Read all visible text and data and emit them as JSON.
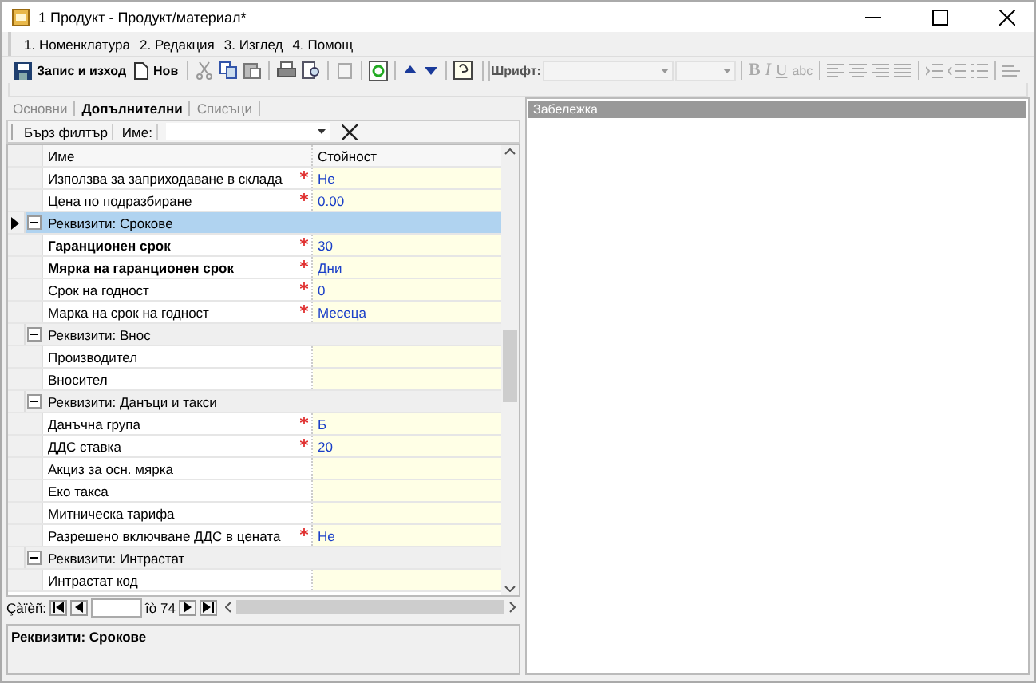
{
  "window": {
    "title": "1 Продукт - Продукт/материал*"
  },
  "menu": [
    "1. Номенклатура",
    "2. Редакция",
    "3. Изглед",
    "4. Помощ"
  ],
  "toolbar": {
    "save_label": "Запис и изход",
    "new_label": "Нов",
    "font_label": "Шрифт:",
    "format_buttons": [
      "B",
      "I",
      "U",
      "abc"
    ]
  },
  "tabs": [
    {
      "label": "Основни",
      "selected": false
    },
    {
      "label": "Допълнителни",
      "selected": true
    },
    {
      "label": "Списъци",
      "selected": false
    }
  ],
  "filter": {
    "label": "Бърз филтър",
    "field_label": "Име:"
  },
  "grid": {
    "columns": [
      "Име",
      "Стойност"
    ],
    "rows": [
      {
        "kind": "field",
        "name": "Използва за заприходаване в склада",
        "bold": false,
        "required": true,
        "value": "Не"
      },
      {
        "kind": "field",
        "name": "Цена по подразбиране",
        "bold": false,
        "required": true,
        "value": "0.00"
      },
      {
        "kind": "group",
        "name": "Реквизити: Срокове",
        "expanded": true,
        "selected": true
      },
      {
        "kind": "field",
        "name": "Гаранционен срок",
        "bold": true,
        "required": true,
        "value": "30"
      },
      {
        "kind": "field",
        "name": "Мярка на гаранционен срок",
        "bold": true,
        "required": true,
        "value": "Дни"
      },
      {
        "kind": "field",
        "name": "Срок на годност",
        "bold": false,
        "required": true,
        "value": "0"
      },
      {
        "kind": "field",
        "name": "Марка на срок на годност",
        "bold": false,
        "required": true,
        "value": "Месеца"
      },
      {
        "kind": "group",
        "name": "Реквизити: Внос",
        "expanded": true,
        "selected": false
      },
      {
        "kind": "field",
        "name": "Производител",
        "bold": false,
        "required": false
      },
      {
        "kind": "field",
        "name": "Вносител",
        "bold": false,
        "required": false
      },
      {
        "kind": "group",
        "name": "Реквизити: Данъци и такси",
        "expanded": true,
        "selected": false
      },
      {
        "kind": "field",
        "name": "Данъчна група",
        "bold": false,
        "required": true,
        "value": "Б"
      },
      {
        "kind": "field",
        "name": "ДДС ставка",
        "bold": false,
        "required": true,
        "value": "20"
      },
      {
        "kind": "field",
        "name": "Акциз за осн. мярка",
        "bold": false,
        "required": false
      },
      {
        "kind": "field",
        "name": "Еко такса",
        "bold": false,
        "required": false
      },
      {
        "kind": "field",
        "name": "Митническа тарифа",
        "bold": false,
        "required": false
      },
      {
        "kind": "field",
        "name": "Разрешено включване ДДС в цената",
        "bold": false,
        "required": true,
        "value": "Не"
      },
      {
        "kind": "group",
        "name": "Реквизити: Интрастат",
        "expanded": true,
        "selected": false
      },
      {
        "kind": "field",
        "name": "Интрастат код",
        "bold": false,
        "required": false
      }
    ]
  },
  "navigator": {
    "label": "Çàïèñ:",
    "count": "îò 74"
  },
  "description": "Реквизити: Срокове",
  "notes": {
    "title": "Забележка"
  }
}
